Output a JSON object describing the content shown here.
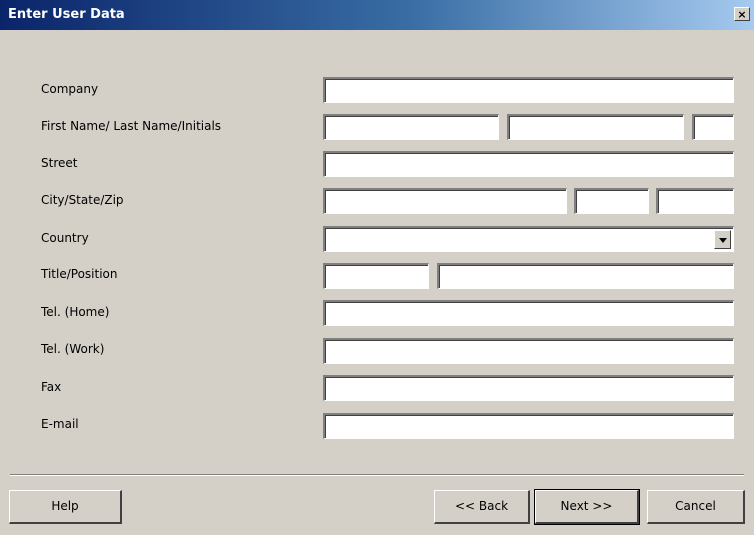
{
  "window": {
    "title": "Enter User Data",
    "close_glyph": "×"
  },
  "labels": {
    "company": "Company",
    "name": "First Name/ Last Name/Initials",
    "street": "Street",
    "city": "City/State/Zip",
    "country": "Country",
    "title": "Title/Position",
    "tel_home": "Tel. (Home)",
    "tel_work": "Tel. (Work)",
    "fax": "Fax",
    "email": "E-mail"
  },
  "values": {
    "company": "",
    "first_name": "",
    "last_name": "",
    "initials": "",
    "street": "",
    "city": "",
    "state": "",
    "zip": "",
    "country": "",
    "title": "",
    "position": "",
    "tel_home": "",
    "tel_work": "",
    "fax": "",
    "email": ""
  },
  "buttons": {
    "help": "Help",
    "back": "<< Back",
    "next": "Next >>",
    "cancel": "Cancel"
  },
  "colors": {
    "titlebar_start": "#0a246a",
    "titlebar_end": "#a6caf0",
    "face": "#d4d0c8"
  }
}
